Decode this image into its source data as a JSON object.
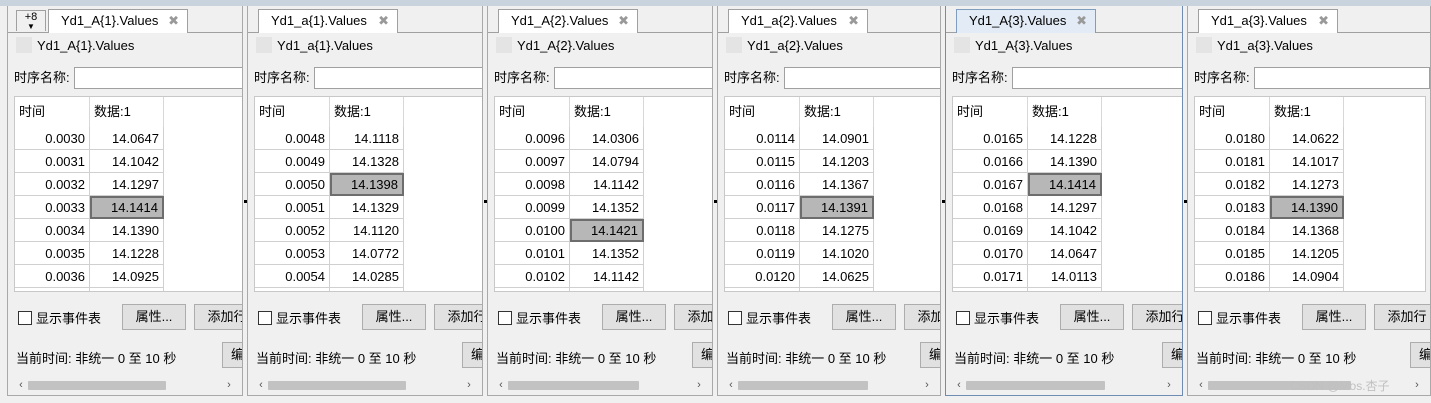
{
  "overflow_tabs": "+8",
  "labels": {
    "series_name": "时序名称:",
    "col_time": "时间",
    "col_data": "数据:1",
    "show_event_table": "显示事件表",
    "properties_button": "属性...",
    "add_row_button": "添加行",
    "current_time": "当前时间: 非统一 0 至 10 秒",
    "stub_button": "编"
  },
  "panels": [
    {
      "tab": "Yd1_A{1}.Values",
      "title": "Yd1_A{1}.Values",
      "rows": [
        {
          "t": "0.0030",
          "v": "14.0647"
        },
        {
          "t": "0.0031",
          "v": "14.1042"
        },
        {
          "t": "0.0032",
          "v": "14.1297"
        },
        {
          "t": "0.0033",
          "v": "14.1414"
        },
        {
          "t": "0.0034",
          "v": "14.1390"
        },
        {
          "t": "0.0035",
          "v": "14.1228"
        },
        {
          "t": "0.0036",
          "v": "14.0925"
        }
      ],
      "selected": 3
    },
    {
      "tab": "Yd1_a{1}.Values",
      "title": "Yd1_a{1}.Values",
      "rows": [
        {
          "t": "0.0048",
          "v": "14.1118"
        },
        {
          "t": "0.0049",
          "v": "14.1328"
        },
        {
          "t": "0.0050",
          "v": "14.1398"
        },
        {
          "t": "0.0051",
          "v": "14.1329"
        },
        {
          "t": "0.0052",
          "v": "14.1120"
        },
        {
          "t": "0.0053",
          "v": "14.0772"
        },
        {
          "t": "0.0054",
          "v": "14.0285"
        }
      ],
      "selected": 2
    },
    {
      "tab": "Yd1_A{2}.Values",
      "title": "Yd1_A{2}.Values",
      "rows": [
        {
          "t": "0.0096",
          "v": "14.0306"
        },
        {
          "t": "0.0097",
          "v": "14.0794"
        },
        {
          "t": "0.0098",
          "v": "14.1142"
        },
        {
          "t": "0.0099",
          "v": "14.1352"
        },
        {
          "t": "0.0100",
          "v": "14.1421"
        },
        {
          "t": "0.0101",
          "v": "14.1352"
        },
        {
          "t": "0.0102",
          "v": "14.1142"
        }
      ],
      "selected": 4
    },
    {
      "tab": "Yd1_a{2}.Values",
      "title": "Yd1_a{2}.Values",
      "rows": [
        {
          "t": "0.0114",
          "v": "14.0901"
        },
        {
          "t": "0.0115",
          "v": "14.1203"
        },
        {
          "t": "0.0116",
          "v": "14.1367"
        },
        {
          "t": "0.0117",
          "v": "14.1391"
        },
        {
          "t": "0.0118",
          "v": "14.1275"
        },
        {
          "t": "0.0119",
          "v": "14.1020"
        },
        {
          "t": "0.0120",
          "v": "14.0625"
        }
      ],
      "selected": 3
    },
    {
      "tab": "Yd1_A{3}.Values",
      "title": "Yd1_A{3}.Values",
      "rows": [
        {
          "t": "0.0165",
          "v": "14.1228"
        },
        {
          "t": "0.0166",
          "v": "14.1390"
        },
        {
          "t": "0.0167",
          "v": "14.1414"
        },
        {
          "t": "0.0168",
          "v": "14.1297"
        },
        {
          "t": "0.0169",
          "v": "14.1042"
        },
        {
          "t": "0.0170",
          "v": "14.0647"
        },
        {
          "t": "0.0171",
          "v": "14.0113"
        }
      ],
      "selected": 2
    },
    {
      "tab": "Yd1_a{3}.Values",
      "title": "Yd1_a{3}.Values",
      "rows": [
        {
          "t": "0.0180",
          "v": "14.0622"
        },
        {
          "t": "0.0181",
          "v": "14.1017"
        },
        {
          "t": "0.0182",
          "v": "14.1273"
        },
        {
          "t": "0.0183",
          "v": "14.1390"
        },
        {
          "t": "0.0184",
          "v": "14.1368"
        },
        {
          "t": "0.0185",
          "v": "14.1205"
        },
        {
          "t": "0.0186",
          "v": "14.0904"
        }
      ],
      "selected": 3
    }
  ],
  "watermark": "CSDN @Mos.杏子"
}
